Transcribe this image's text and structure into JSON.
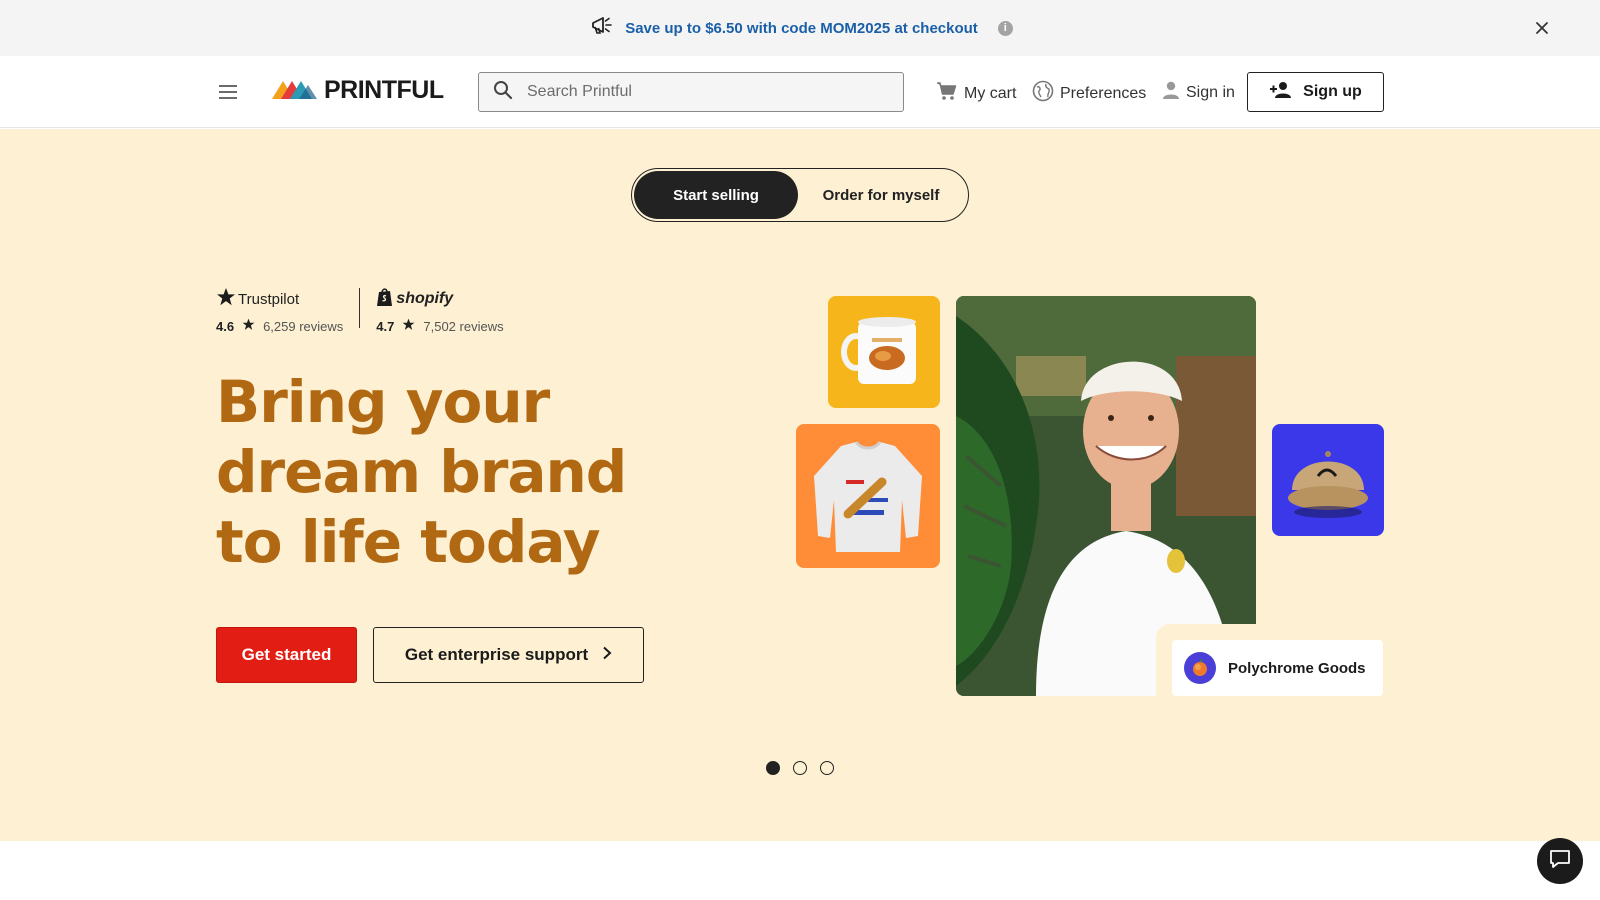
{
  "promo": {
    "text": "Save up to $6.50 with code MOM2025 at checkout",
    "info": "i",
    "icon": "megaphone-icon",
    "close_icon": "close-icon"
  },
  "header": {
    "logo_text": "PRINTFUL",
    "search_placeholder": "Search Printful",
    "cart_label": "My cart",
    "preferences_label": "Preferences",
    "signin_label": "Sign in",
    "signup_label": "Sign up"
  },
  "hero": {
    "toggle": {
      "active": "Start selling",
      "inactive": "Order for myself"
    },
    "reviews": [
      {
        "brand": "Trustpilot",
        "score": "4.6",
        "count": "6,259 reviews"
      },
      {
        "brand": "shopify",
        "score": "4.7",
        "count": "7,502 reviews"
      }
    ],
    "headline": "Bring your dream brand to life today",
    "cta_primary": "Get started",
    "cta_secondary": "Get enterprise support",
    "shop_card": "Polychrome Goods",
    "carousel": {
      "slides": 3,
      "active": 1
    }
  },
  "colors": {
    "promo_text": "#1a5fa8",
    "hero_bg": "#fdf0d3",
    "headline": "#b16812",
    "primary_button": "#e11d14"
  }
}
